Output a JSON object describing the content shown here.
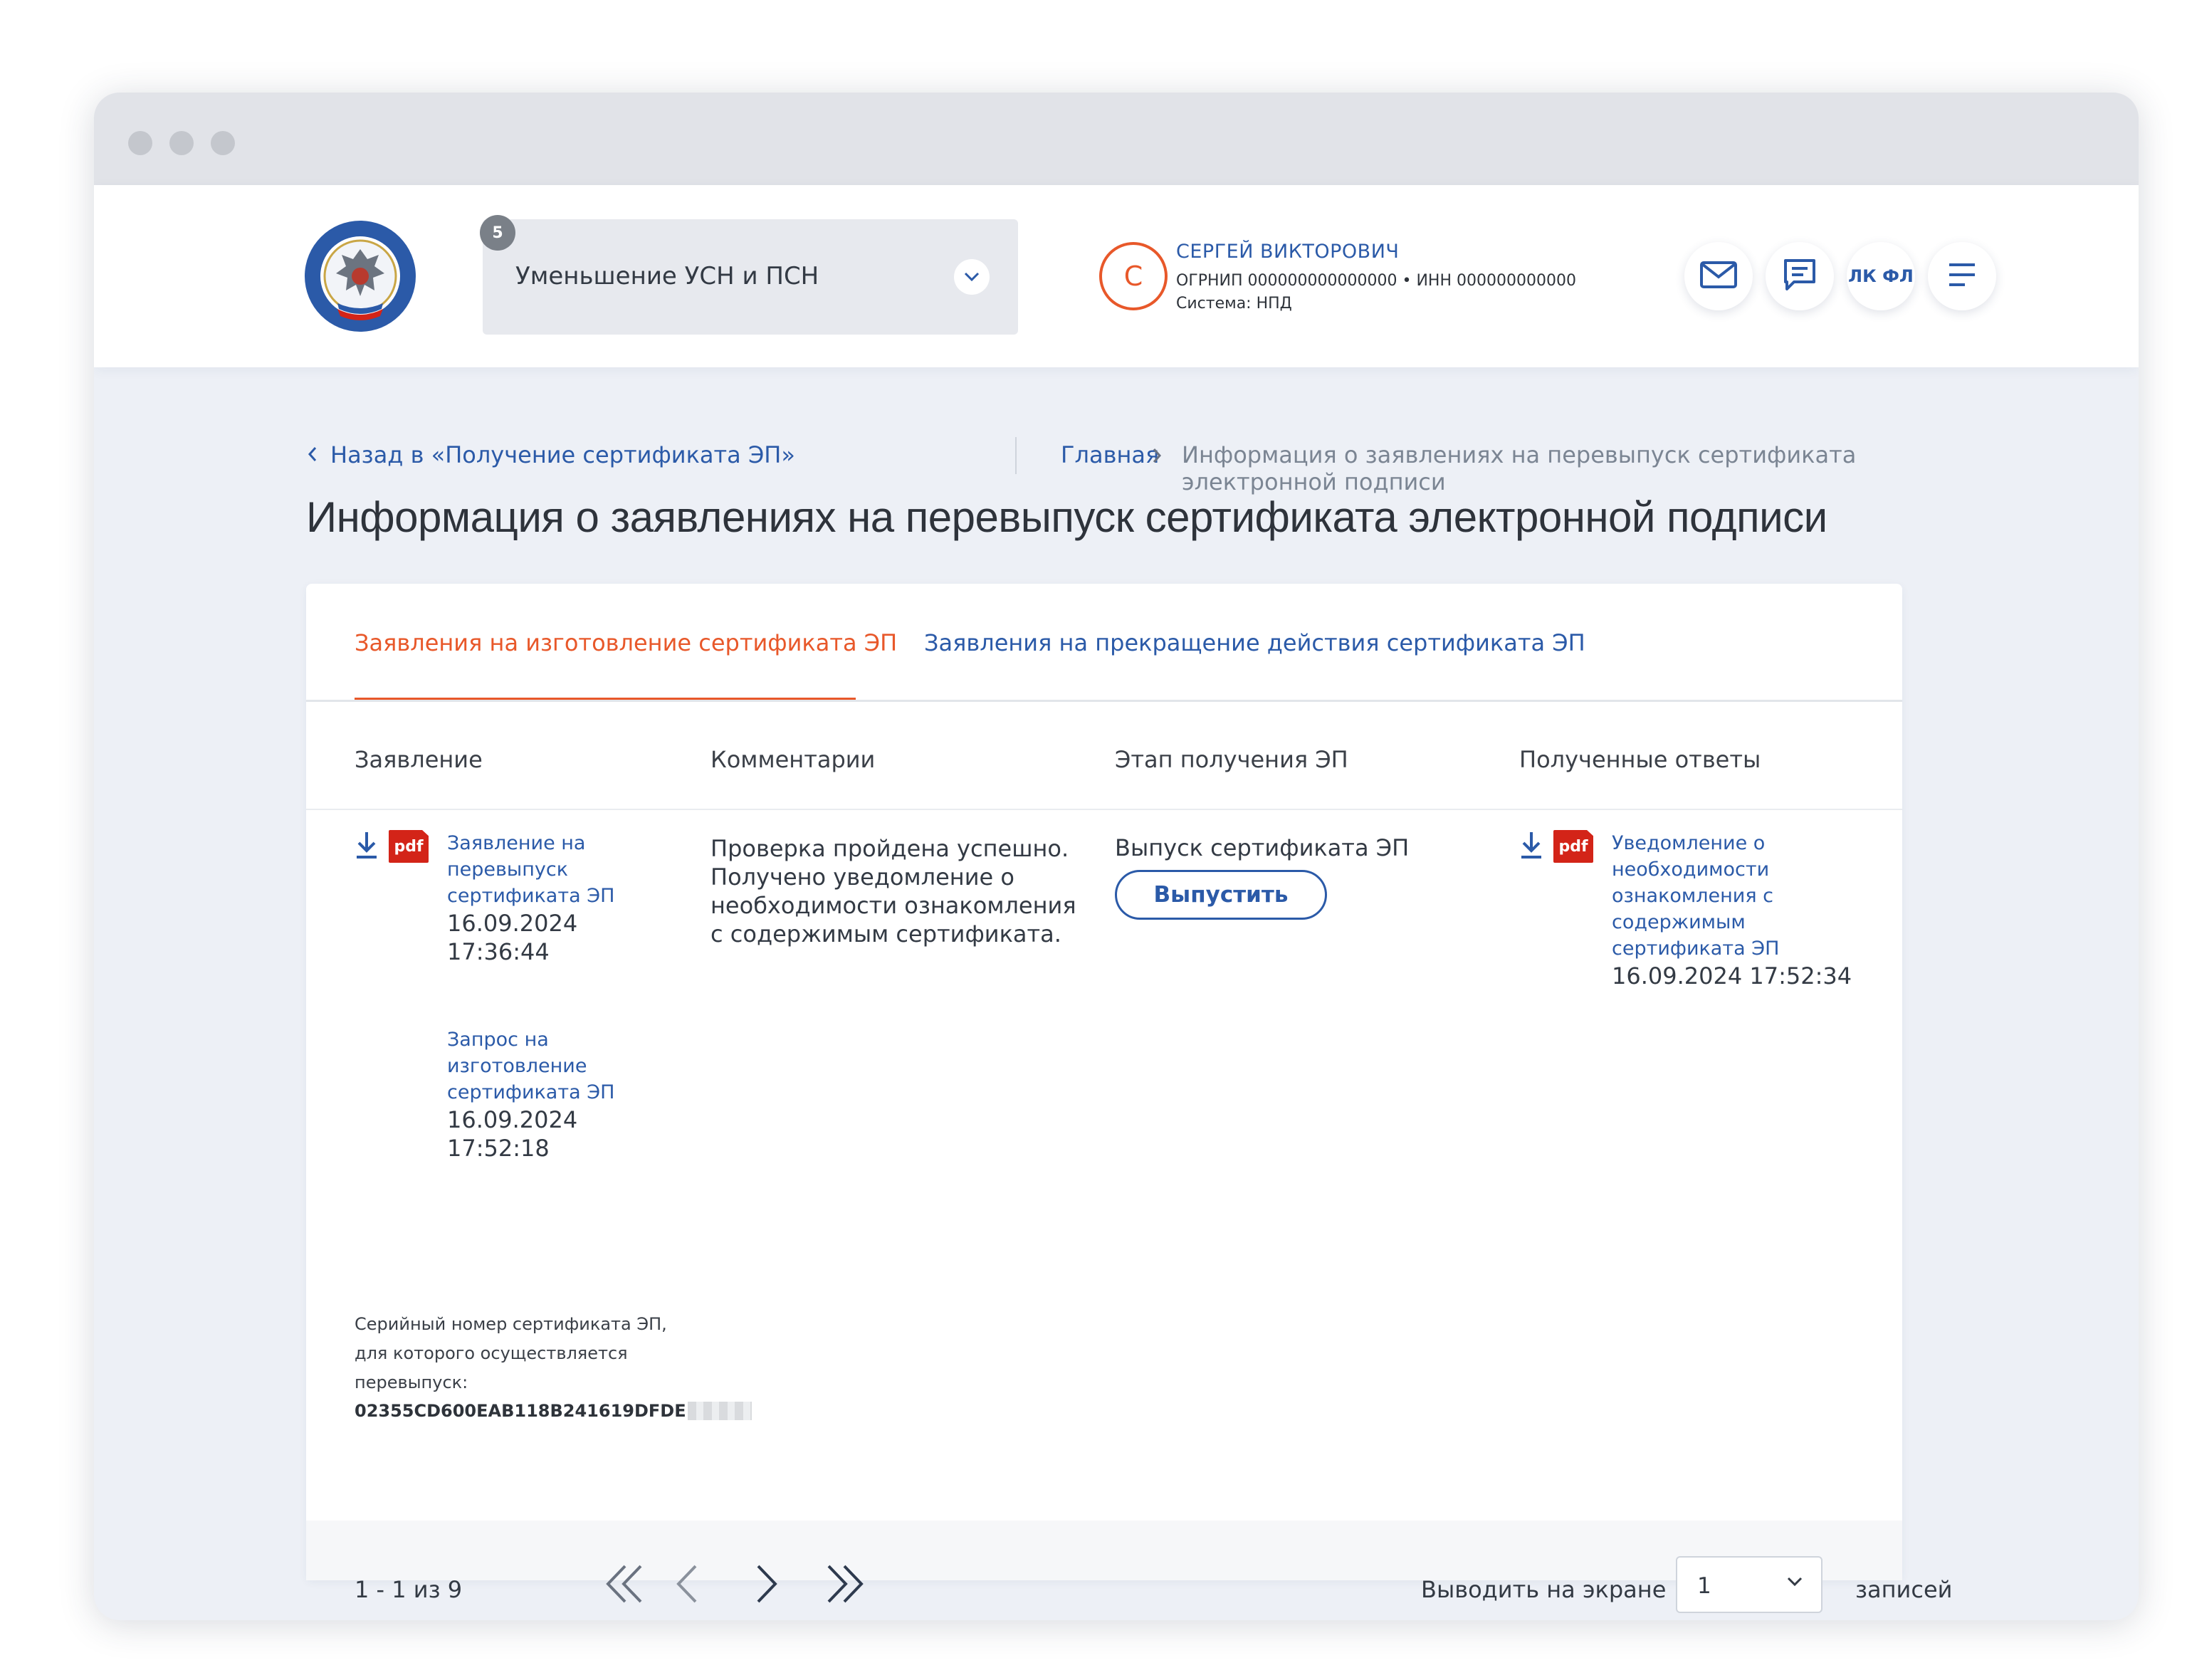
{
  "header": {
    "service_count": "5",
    "service_name": "Уменьшение УСН и ПСН",
    "user_initial": "С",
    "user_name": "СЕРГЕЙ ВИКТОРОВИЧ",
    "user_ogrn": "ОГРНИП 000000000000000 • ИНН 000000000000",
    "user_system": "Система: НПД",
    "lk_label": "ЛК ФЛ"
  },
  "breadcrumbs": {
    "back": "Назад в «Получение сертификата ЭП»",
    "home": "Главная",
    "current": "Информация о заявлениях на перевыпуск сертификата электронной подписи"
  },
  "page_title": "Информация о заявлениях на перевыпуск сертификата электронной подписи",
  "tabs": [
    {
      "label": "Заявления на изготовление сертификата ЭП",
      "active": true
    },
    {
      "label": "Заявления на прекращение действия сертификата ЭП",
      "active": false
    }
  ],
  "table": {
    "columns": [
      "Заявление",
      "Комментарии",
      "Этап получения ЭП",
      "Полученные ответы"
    ],
    "row": {
      "application": {
        "pdf_badge": "pdf",
        "doc1_title": "Заявление на перевыпуск сертификата ЭП",
        "doc1_date": "16.09.2024",
        "doc1_time": "17:36:44",
        "doc2_title": "Запрос на изготовление сертификата ЭП",
        "doc2_date": "16.09.2024",
        "doc2_time": "17:52:18",
        "serial_caption": "Серийный номер сертификата ЭП, для которого осуществляется перевыпуск:",
        "serial_value": "02355CD600EAB118B241619DFDE"
      },
      "comment": "Проверка пройдена успешно. Получено уведомление о необходимости ознакомления с содержимым сертификата.",
      "stage": "Выпуск сертификата ЭП",
      "stage_button": "Выпустить",
      "response": {
        "pdf_badge": "pdf",
        "title": "Уведомление о необходимости ознакомления с содержимым сертификата ЭП",
        "datetime": "16.09.2024 17:52:34"
      }
    }
  },
  "pager": {
    "range": "1 - 1 из 9",
    "per_page_label": "Выводить на экране",
    "per_page_value": "1",
    "records_label": "записей"
  },
  "colors": {
    "accent": "#e8582a",
    "link": "#2b5aa8",
    "pdf": "#d32418"
  }
}
